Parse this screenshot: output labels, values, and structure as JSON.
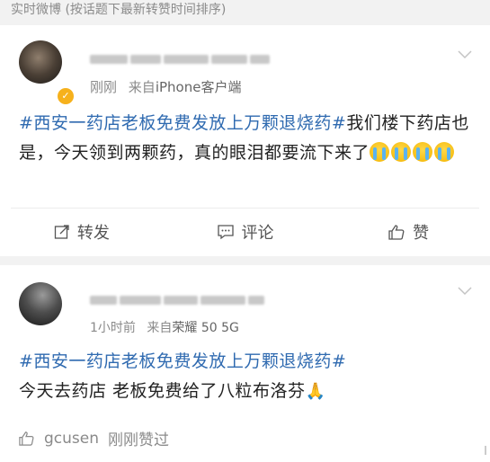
{
  "header": {
    "title": "实时微博 (按话题下最新转赞时间排序)"
  },
  "posts": [
    {
      "time": "刚刚",
      "source_prefix": "来自",
      "source": "iPhone客户端",
      "topic": "#西安一药店老板免费发放上万颗退烧药#",
      "text": "我们楼下药店也是，今天领到两颗药，真的眼泪都要流下来了",
      "emoji_name": "crying-face-emoji",
      "actions": {
        "repost": "转发",
        "comment": "评论",
        "like": "赞"
      }
    },
    {
      "time": "1小时前",
      "source_prefix": "来自",
      "source": "荣耀 50 5G",
      "topic": "#西安一药店老板免费发放上万颗退烧药#",
      "text": "今天去药店 老板免费给了八粒布洛芬",
      "emoji_name": "praying-hands-emoji",
      "like_user": "gcusen",
      "like_status": "刚刚赞过"
    }
  ],
  "colors": {
    "topic": "#2f6ab0",
    "background": "#f2f2f2",
    "meta": "#8a8a8a"
  }
}
